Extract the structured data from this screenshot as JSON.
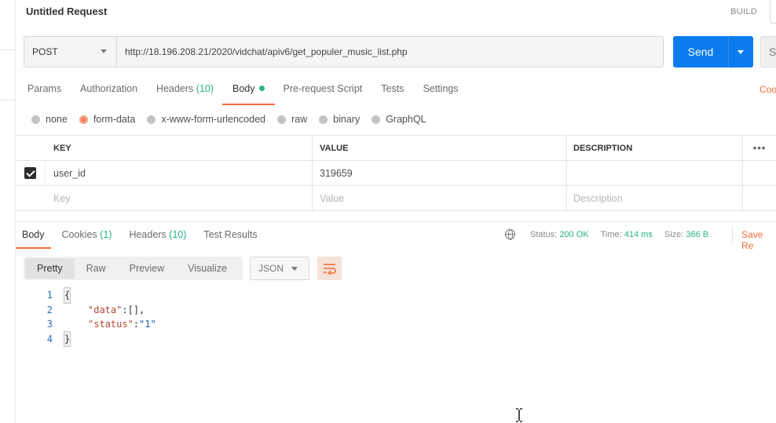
{
  "window": {
    "title": "Untitled Request",
    "build_label": "BUILD"
  },
  "request": {
    "method": "POST",
    "url": "http://18.196.208.21/2020/vidchat/apiv6/get_populer_music_list.php",
    "send_label": "Send",
    "save_label_partial": "S",
    "tabs": [
      {
        "label": "Params"
      },
      {
        "label": "Authorization"
      },
      {
        "label": "Headers",
        "count": "(10)"
      },
      {
        "label": "Body",
        "active": true
      },
      {
        "label": "Pre-request Script"
      },
      {
        "label": "Tests"
      },
      {
        "label": "Settings"
      }
    ],
    "code_link_partial": "Coo",
    "body_types": [
      "none",
      "form-data",
      "x-www-form-urlencoded",
      "raw",
      "binary",
      "GraphQL"
    ],
    "body_type_selected": "form-data",
    "params_table": {
      "headers": {
        "key": "KEY",
        "value": "VALUE",
        "description": "DESCRIPTION",
        "more": "•••"
      },
      "rows": [
        {
          "checked": true,
          "key": "user_id",
          "value": "319659",
          "description": ""
        }
      ],
      "placeholder": {
        "key": "Key",
        "value": "Value",
        "description": "Description"
      }
    }
  },
  "response": {
    "tabs": [
      {
        "label": "Body",
        "active": true
      },
      {
        "label": "Cookies",
        "count": "(1)"
      },
      {
        "label": "Headers",
        "count": "(10)"
      },
      {
        "label": "Test Results"
      }
    ],
    "status": {
      "label": "Status:",
      "value": "200 OK"
    },
    "time": {
      "label": "Time:",
      "value": "414 ms"
    },
    "size": {
      "label": "Size:",
      "value": "366 B"
    },
    "save_partial": "Save Re",
    "view_tabs": [
      "Pretty",
      "Raw",
      "Preview",
      "Visualize"
    ],
    "view_selected": "Pretty",
    "format": "JSON",
    "code": {
      "line_numbers": [
        "1",
        "2",
        "3",
        "4"
      ],
      "open_brace": "{",
      "close_brace": "}",
      "data_key": "\"data\"",
      "data_val": "[],",
      "status_key": "\"status\"",
      "status_val": "\"1\""
    }
  },
  "colors": {
    "accent": "#f26b3a",
    "send": "#097bed",
    "ok": "#26b47f"
  }
}
